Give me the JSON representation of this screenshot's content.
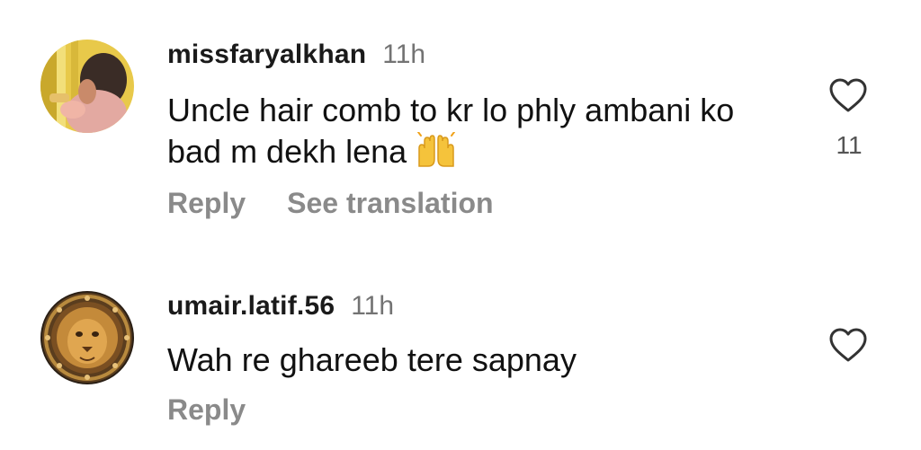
{
  "comments": [
    {
      "username": "missfaryalkhan",
      "time": "11h",
      "text": "Uncle hair comb to kr lo phly ambani ko bad m dekh lena",
      "emoji": "raising-hands",
      "like_count": "11",
      "actions": {
        "reply": "Reply",
        "translate": "See translation"
      }
    },
    {
      "username": "umair.latif.56",
      "time": "11h",
      "text": "Wah re ghareeb tere sapnay",
      "like_count": "",
      "actions": {
        "reply": "Reply"
      }
    }
  ],
  "colors": {
    "text": "#111111",
    "muted": "#737373",
    "action": "#8a8a8a"
  },
  "icons": {
    "like": "heart-outline-icon",
    "emoji": "raising-hands-icon"
  }
}
